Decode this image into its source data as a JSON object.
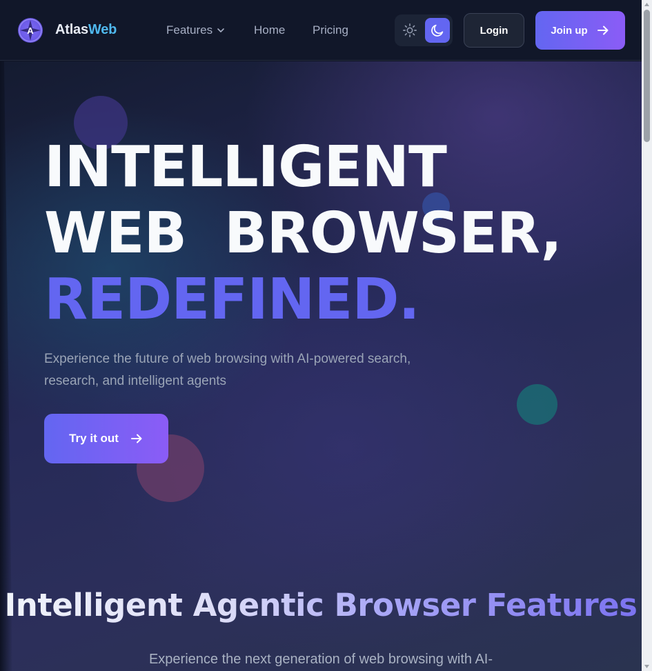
{
  "brand": {
    "name_part1": "Atlas",
    "name_part2": "Web",
    "logo_letter": "A"
  },
  "nav": {
    "features": "Features",
    "home": "Home",
    "pricing": "Pricing"
  },
  "theme_toggle": {
    "light_icon": "sun-icon",
    "dark_icon": "moon-icon",
    "active": "dark"
  },
  "header_actions": {
    "login": "Login",
    "join": "Join up"
  },
  "hero": {
    "line1": "INTELLIGENT",
    "line2": "WEB  BROWSER,",
    "line3_accent": "REDEFINED",
    "line3_dot": ".",
    "subtitle": "Experience the future of web browsing with AI-powered search, research, and intelligent agents",
    "cta": "Try it out"
  },
  "features_section": {
    "title": "Intelligent Agentic Browser Features",
    "subtitle": "Experience the next generation of web browsing with AI-"
  },
  "colors": {
    "accent": "#6366f1",
    "accent_secondary": "#8b5cf6",
    "brand_web": "#4fb8ee",
    "background": "#0f1424"
  }
}
